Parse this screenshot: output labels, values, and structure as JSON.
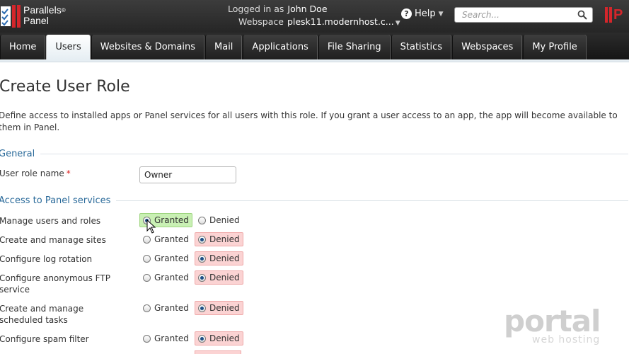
{
  "header": {
    "logo_line1": "Parallels",
    "logo_reg": "®",
    "logo_line2": "Panel",
    "logged_in_label": "Logged in as",
    "user_name": "John Doe",
    "webspace_label": "Webspace",
    "webspace_value": "plesk11.modernhost.c...",
    "help_label": "Help",
    "search_placeholder": "Search...",
    "brand_right_text": "P",
    "colors": {
      "brand_red": "#d4262b",
      "bar_dark": "#262626"
    }
  },
  "nav": {
    "tabs": [
      {
        "label": "Home",
        "active": false
      },
      {
        "label": "Users",
        "active": true
      },
      {
        "label": "Websites & Domains",
        "active": false
      },
      {
        "label": "Mail",
        "active": false
      },
      {
        "label": "Applications",
        "active": false
      },
      {
        "label": "File Sharing",
        "active": false
      },
      {
        "label": "Statistics",
        "active": false
      },
      {
        "label": "Webspaces",
        "active": false
      },
      {
        "label": "My Profile",
        "active": false
      }
    ]
  },
  "page": {
    "title": "Create User Role",
    "description": "Define access to installed apps or Panel services for all users with this role. If you grant a user access to an app, the app will become available to them in Panel."
  },
  "general": {
    "section_title": "General",
    "role_name_label": "User role name",
    "required_mark": "*",
    "role_name_value": "Owner"
  },
  "access": {
    "section_title": "Access to Panel services",
    "granted_label": "Granted",
    "denied_label": "Denied",
    "permissions": [
      {
        "label": "Manage users and roles",
        "value": "granted"
      },
      {
        "label": "Create and manage sites",
        "value": "denied"
      },
      {
        "label": "Configure log rotation",
        "value": "denied"
      },
      {
        "label": "Configure anonymous FTP service",
        "value": "denied"
      },
      {
        "label": "Create and manage scheduled tasks",
        "value": "denied"
      },
      {
        "label": "Configure spam filter",
        "value": "denied"
      }
    ],
    "colors": {
      "granted_bg": "#c9f0b4",
      "denied_bg": "#fbd3d3",
      "section_title": "#2a6a9a"
    }
  },
  "watermark": {
    "line1": "portal",
    "line2": "web hosting"
  }
}
